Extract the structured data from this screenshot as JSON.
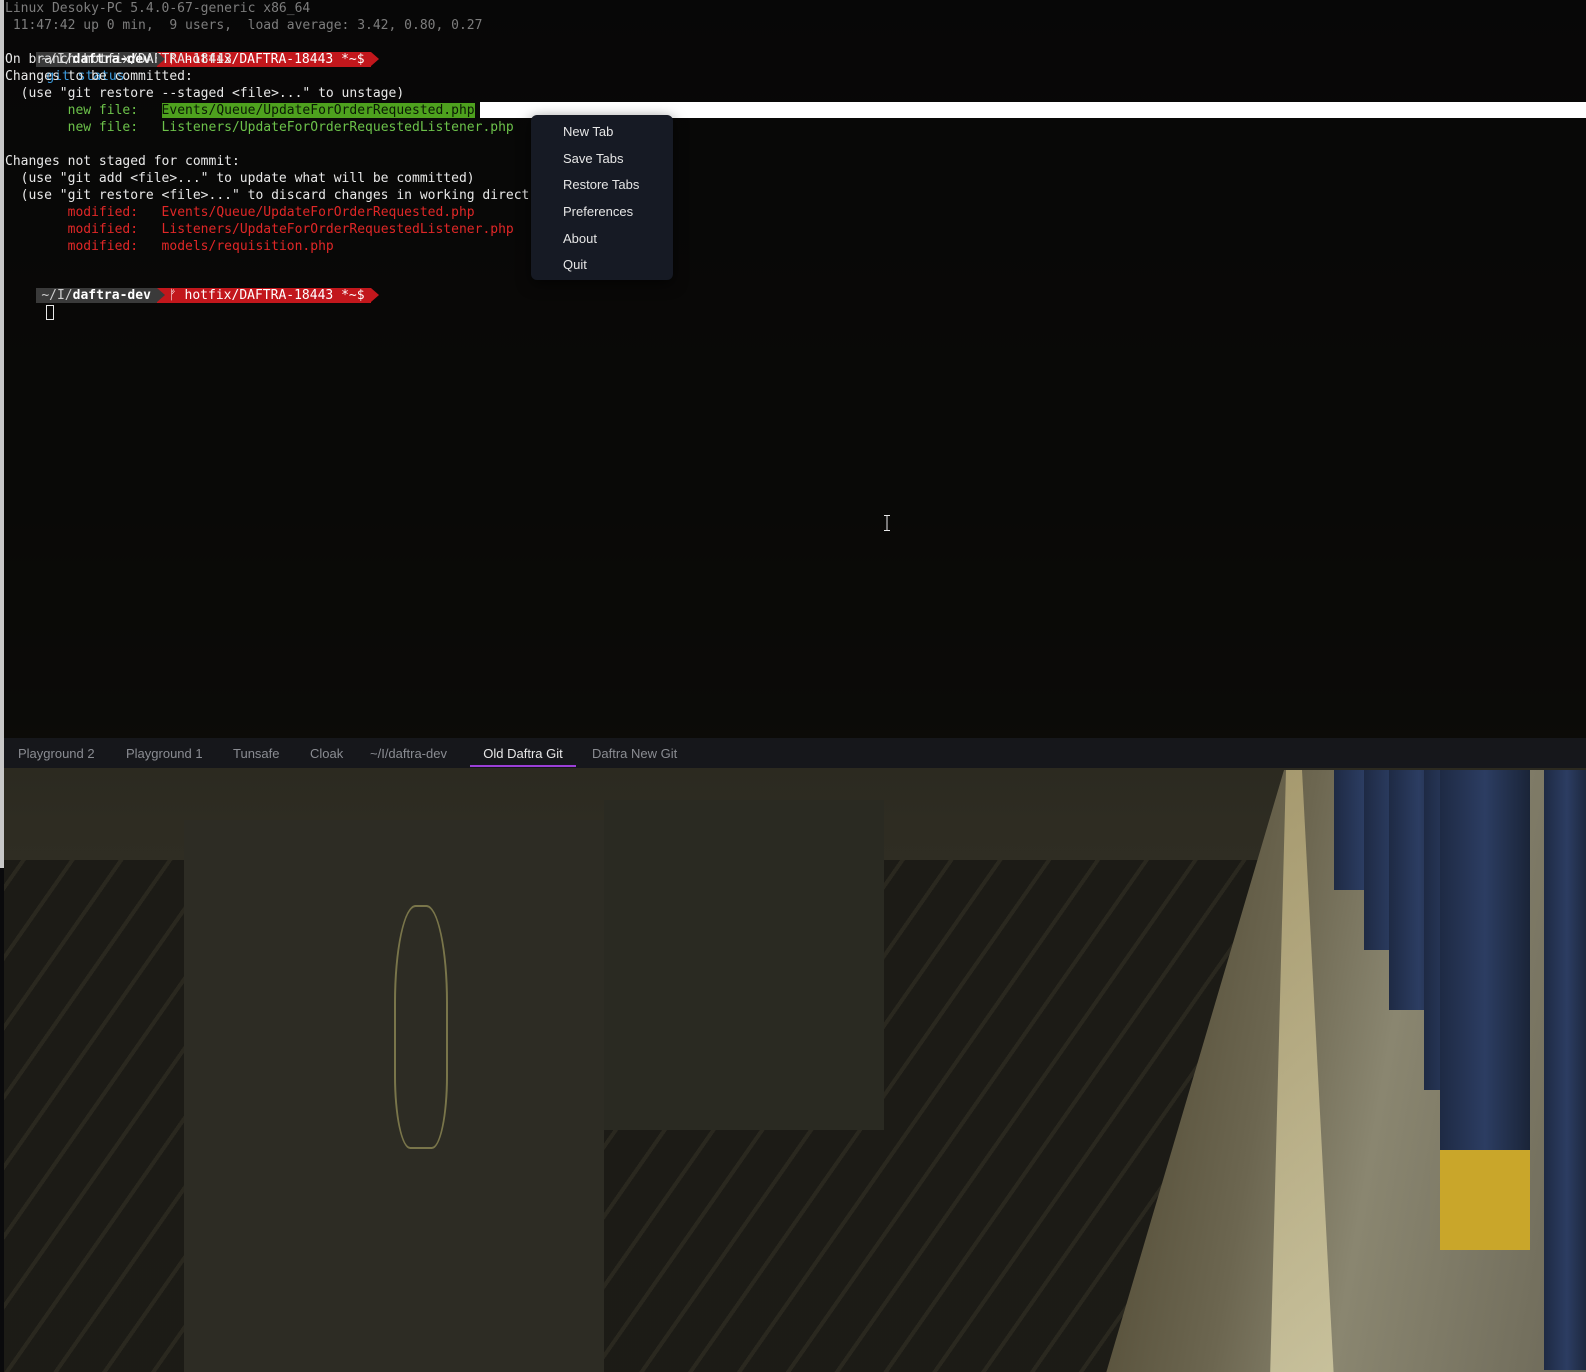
{
  "terminal": {
    "header": {
      "sysinfo": "Linux Desoky-PC 5.4.0-67-generic x86_64",
      "uptime": " 11:47:42 up 0 min,  9 users,  load average: 3.42, 0.80, 0.27"
    },
    "prompt": {
      "path_prefix": "~/I/",
      "path_dir": "daftra-dev",
      "branch": "ᚠ hotfix/DAFTRA-18443 *~$"
    },
    "command": "git status",
    "output": {
      "on_branch": "On branch hotfix/DAFTRA-18443",
      "staged_header": "Changes to be committed:",
      "staged_hint": "  (use \"git restore --staged <file>...\" to unstage)",
      "staged": [
        {
          "status": "        new file:   ",
          "path": "Events/Queue/UpdateForOrderRequested.php"
        },
        {
          "status": "        new file:   ",
          "path": "Listeners/UpdateForOrderRequestedListener.php"
        }
      ],
      "unstaged_header": "Changes not staged for commit:",
      "unstaged_hint1": "  (use \"git add <file>...\" to update what will be committed)",
      "unstaged_hint2": "  (use \"git restore <file>...\" to discard changes in working direct",
      "unstaged": [
        {
          "status": "        modified:   ",
          "path": "Events/Queue/UpdateForOrderRequested.php"
        },
        {
          "status": "        modified:   ",
          "path": "Listeners/UpdateForOrderRequestedListener.php"
        },
        {
          "status": "        modified:   ",
          "path": "models/requisition.php"
        }
      ]
    }
  },
  "context_menu": {
    "items": [
      "New Tab",
      "Save Tabs",
      "Restore Tabs",
      "Preferences",
      "About",
      "Quit"
    ]
  },
  "tabs": {
    "items": [
      "Playground 2",
      "Playground 1",
      "Tunsafe",
      "Cloak",
      "~/I/daftra-dev",
      "Old Daftra Git",
      "Daftra New Git"
    ],
    "active": "Old Daftra Git"
  },
  "colors": {
    "branch_segment": "#c2171c",
    "path_segment": "#3a3a3a",
    "new_file": "#6cc24a",
    "modified": "#e02727",
    "active_tab_underline": "#9b3fd6",
    "menu_background": "#161a24"
  },
  "icons": {
    "branch": "git-branch-icon",
    "text_cursor": "i-beam-cursor-icon"
  }
}
